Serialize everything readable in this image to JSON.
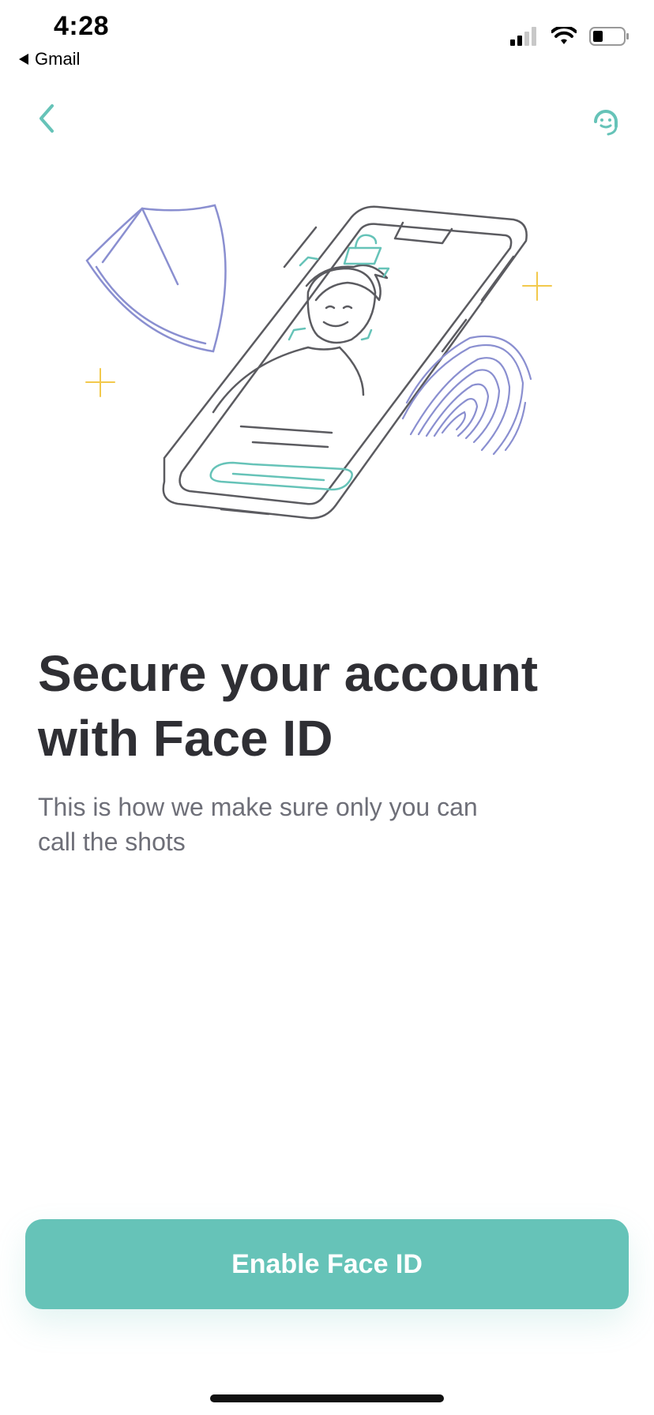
{
  "status_bar": {
    "time": "4:28",
    "back_app_label": "Gmail",
    "icons": [
      "cellular-signal-icon",
      "wifi-icon",
      "battery-icon"
    ]
  },
  "nav": {
    "back_icon": "chevron-left-icon",
    "support_icon": "customer-support-icon"
  },
  "illustration": {
    "elements": [
      "shield-icon",
      "phone-face-scan-illustration",
      "fingerprint-icon",
      "sparkle-icon"
    ]
  },
  "content": {
    "title": "Secure your account with Face ID",
    "subtitle": "This is how we make sure only you can call the shots"
  },
  "cta": {
    "label": "Enable Face ID"
  },
  "colors": {
    "accent": "#66c3b8",
    "title": "#2f2f34",
    "subtitle": "#6e6f78",
    "illustration_line": "#5b5b60",
    "shield_fingerprint": "#8a8fd0",
    "sparkle": "#f2c94c"
  }
}
